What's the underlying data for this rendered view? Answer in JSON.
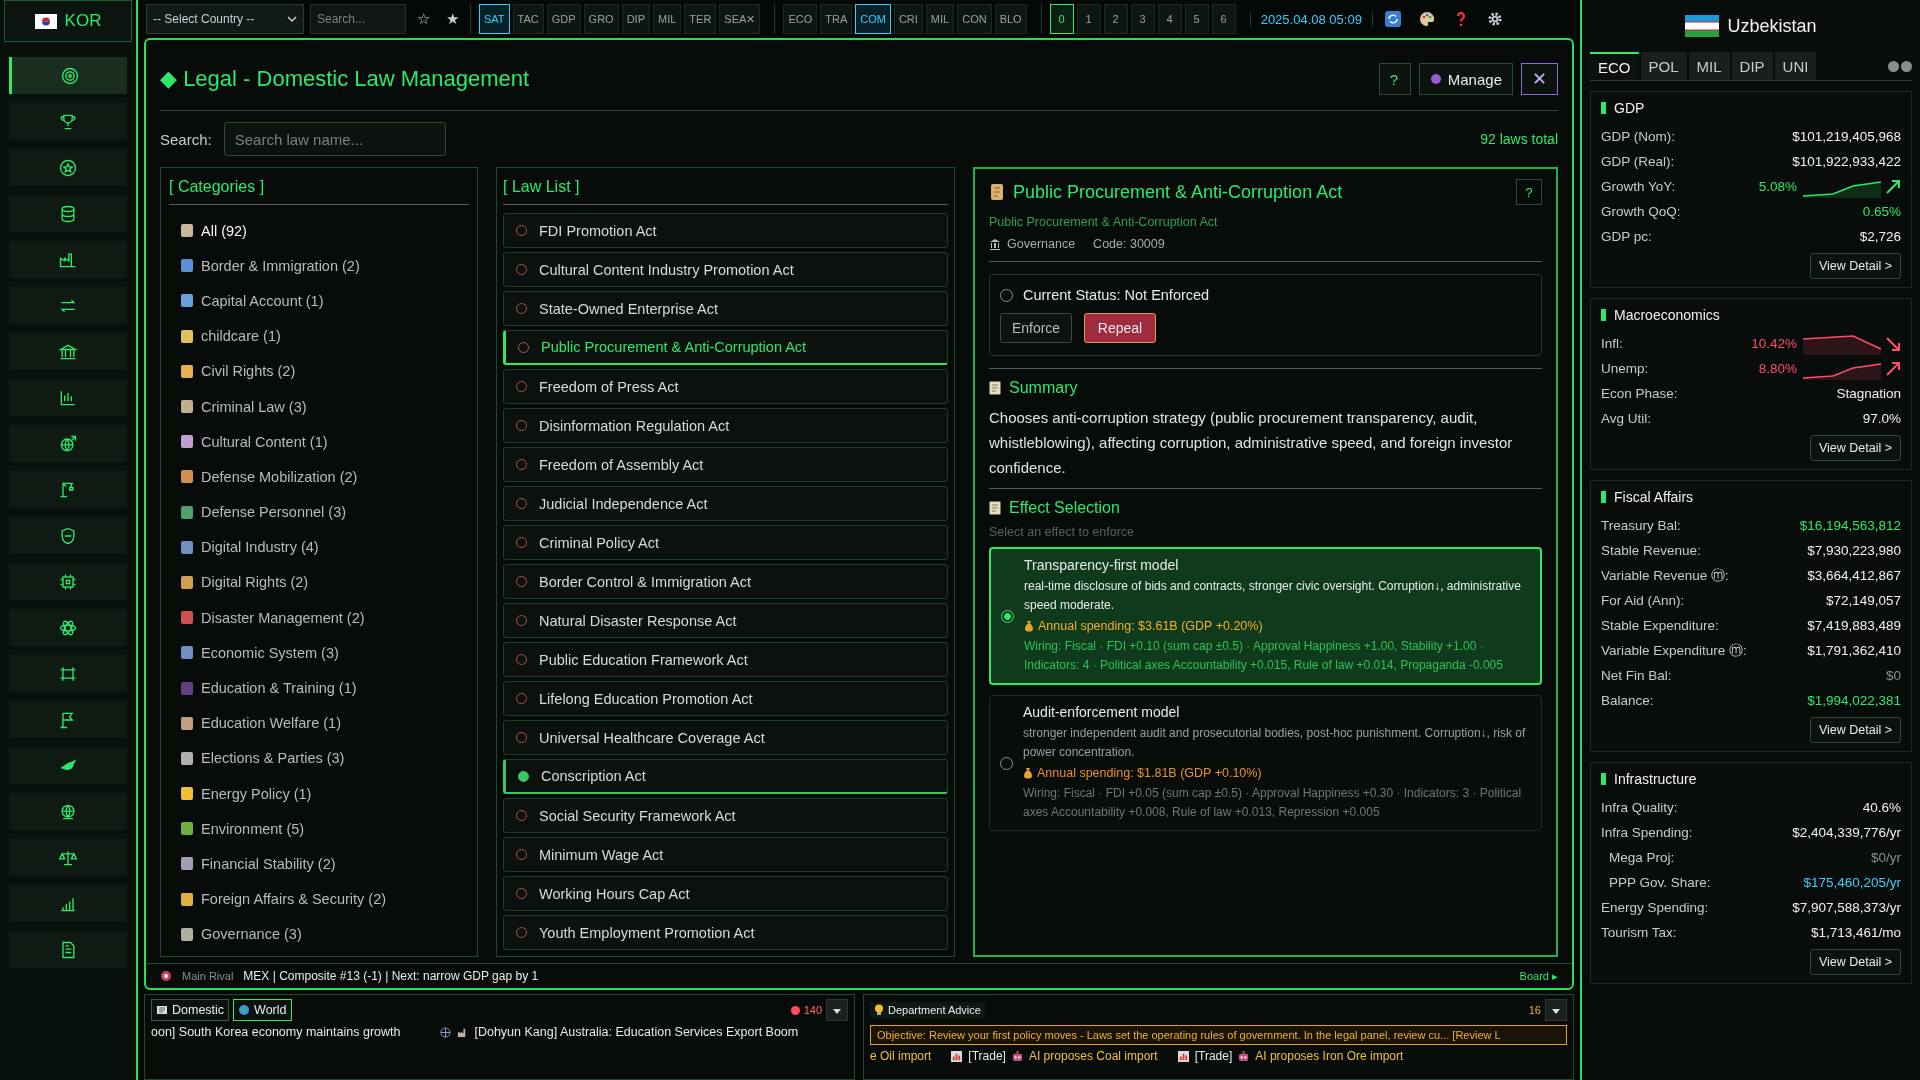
{
  "player": {
    "code": "KOR"
  },
  "toolbar": {
    "country_select": "-- Select Country --",
    "search": {
      "placeholder": "Search..."
    },
    "star_buttons": [
      "☆",
      "★"
    ],
    "layer_tabs": [
      {
        "label": "SAT",
        "selected": true
      },
      {
        "label": "TAC",
        "selected": false
      },
      {
        "label": "GDP",
        "selected": false
      },
      {
        "label": "GRO",
        "selected": false
      },
      {
        "label": "DIP",
        "selected": false
      },
      {
        "label": "MIL",
        "selected": false
      },
      {
        "label": "TER",
        "selected": false
      },
      {
        "label": "SEA✕",
        "selected": false
      }
    ],
    "view_tabs": [
      {
        "label": "ECO",
        "selected": false
      },
      {
        "label": "TRA",
        "selected": false
      },
      {
        "label": "COM",
        "selected": true
      },
      {
        "label": "CRI",
        "selected": false
      },
      {
        "label": "MIL",
        "selected": false
      },
      {
        "label": "CON",
        "selected": false
      },
      {
        "label": "BLO",
        "selected": false
      }
    ],
    "speed_tabs": [
      {
        "label": "0",
        "selected": true
      },
      {
        "label": "1",
        "selected": false
      },
      {
        "label": "2",
        "selected": false
      },
      {
        "label": "3",
        "selected": false
      },
      {
        "label": "4",
        "selected": false
      },
      {
        "label": "5",
        "selected": false
      },
      {
        "label": "6",
        "selected": false
      }
    ],
    "datetime": "2025.04.08 05:09"
  },
  "sidebar": {
    "items": [
      {
        "selected": true
      },
      {
        "selected": false
      },
      {
        "selected": false
      },
      {
        "selected": false
      },
      {
        "selected": false
      },
      {
        "selected": false
      },
      {
        "selected": false
      },
      {
        "selected": false
      },
      {
        "selected": false
      },
      {
        "selected": false
      },
      {
        "selected": false
      },
      {
        "selected": false
      },
      {
        "selected": false
      },
      {
        "selected": false
      },
      {
        "selected": false
      },
      {
        "selected": false
      },
      {
        "selected": false
      },
      {
        "selected": false
      },
      {
        "selected": false
      },
      {
        "selected": false
      }
    ]
  },
  "modal": {
    "title": "Legal - Domestic Law Management",
    "title_mark": "◆",
    "help": "?",
    "manage": "Manage",
    "close": "✕",
    "search_label": "Search:",
    "search": {
      "placeholder": "Search law name..."
    },
    "total": "92 laws total",
    "categories_title": "[ Categories ]",
    "categories": [
      {
        "label": "All (92)",
        "selected": true
      },
      {
        "label": "Border & Immigration (2)",
        "selected": false
      },
      {
        "label": "Capital Account (1)",
        "selected": false
      },
      {
        "label": "childcare (1)",
        "selected": false
      },
      {
        "label": "Civil Rights (2)",
        "selected": false
      },
      {
        "label": "Criminal Law (3)",
        "selected": false
      },
      {
        "label": "Cultural Content (1)",
        "selected": false
      },
      {
        "label": "Defense Mobilization (2)",
        "selected": false
      },
      {
        "label": "Defense Personnel (3)",
        "selected": false
      },
      {
        "label": "Digital Industry (4)",
        "selected": false
      },
      {
        "label": "Digital Rights (2)",
        "selected": false
      },
      {
        "label": "Disaster Management (2)",
        "selected": false
      },
      {
        "label": "Economic System (3)",
        "selected": false
      },
      {
        "label": "Education & Training (1)",
        "selected": false
      },
      {
        "label": "Education Welfare (1)",
        "selected": false
      },
      {
        "label": "Elections & Parties (3)",
        "selected": false
      },
      {
        "label": "Energy Policy (1)",
        "selected": false
      },
      {
        "label": "Environment (5)",
        "selected": false
      },
      {
        "label": "Financial Stability (2)",
        "selected": false
      },
      {
        "label": "Foreign Affairs & Security (2)",
        "selected": false
      },
      {
        "label": "Governance (3)",
        "selected": false
      }
    ],
    "laws_title": "[ Law List ]",
    "laws": [
      {
        "name": "FDI Promotion Act",
        "selected": false,
        "enforced": false
      },
      {
        "name": "Cultural Content Industry Promotion Act",
        "selected": false,
        "enforced": false
      },
      {
        "name": "State-Owned Enterprise Act",
        "selected": false,
        "enforced": false
      },
      {
        "name": "Public Procurement & Anti-Corruption Act",
        "selected": true,
        "enforced": false
      },
      {
        "name": "Freedom of Press Act",
        "selected": false,
        "enforced": false
      },
      {
        "name": "Disinformation Regulation Act",
        "selected": false,
        "enforced": false
      },
      {
        "name": "Freedom of Assembly Act",
        "selected": false,
        "enforced": false
      },
      {
        "name": "Judicial Independence Act",
        "selected": false,
        "enforced": false
      },
      {
        "name": "Criminal Policy Act",
        "selected": false,
        "enforced": false
      },
      {
        "name": "Border Control & Immigration Act",
        "selected": false,
        "enforced": false
      },
      {
        "name": "Natural Disaster Response Act",
        "selected": false,
        "enforced": false
      },
      {
        "name": "Public Education Framework Act",
        "selected": false,
        "enforced": false
      },
      {
        "name": "Lifelong Education Promotion Act",
        "selected": false,
        "enforced": false
      },
      {
        "name": "Universal Healthcare Coverage Act",
        "selected": false,
        "enforced": false
      },
      {
        "name": "Conscription Act",
        "selected": false,
        "enforced": true
      },
      {
        "name": "Social Security Framework Act",
        "selected": false,
        "enforced": false
      },
      {
        "name": "Minimum Wage Act",
        "selected": false,
        "enforced": false
      },
      {
        "name": "Working Hours Cap Act",
        "selected": false,
        "enforced": false
      },
      {
        "name": "Youth Employment Promotion Act",
        "selected": false,
        "enforced": false
      }
    ],
    "detail": {
      "title": "Public Procurement & Anti-Corruption Act",
      "subtitle": "Public Procurement & Anti-Corruption Act",
      "category": "Governance",
      "code": "Code: 30009",
      "help": "?",
      "status": {
        "label": "Current Status: Not Enforced",
        "enforced": false
      },
      "enforce": "Enforce",
      "repeal": "Repeal",
      "summary_title": "Summary",
      "summary": "Chooses anti-corruption strategy (public procurement transparency, audit, whistleblowing), affecting corruption, administrative speed, and foreign investor confidence.",
      "effects_title": "Effect Selection",
      "effects_hint": "Select an effect to enforce",
      "effects": [
        {
          "title": "Transparency-first model",
          "description": "real-time disclosure of bids and contracts, stronger civic oversight. Corruption↓, administrative speed moderate.",
          "spending": "Annual spending: $3.61B (GDP +0.20%)",
          "wiring": "Wiring: Fiscal · FDI +0.10 (sum cap ±0.5) · Approval Happiness +1.00, Stability +1.00 · Indicators: 4 · Political axes Accountability +0.015, Rule of law +0.014, Propaganda -0.005",
          "selected": true
        },
        {
          "title": "Audit-enforcement model",
          "description": "stronger independent audit and prosecutorial bodies, post-hoc punishment. Corruption↓, risk of power concentration.",
          "spending": "Annual spending: $1.81B (GDP +0.10%)",
          "wiring": "Wiring: Fiscal · FDI +0.05 (sum cap ±0.5) · Approval Happiness +0.30 · Indicators: 3 · Political axes Accountability +0.008, Rule of law +0.013, Repression +0.005",
          "selected": false
        }
      ]
    },
    "footer": {
      "rival_label": "Main Rival",
      "rival_info": "MEX | Composite #13 (-1) | Next: narrow GDP gap by 1",
      "board": "Board ▸"
    }
  },
  "news": {
    "tabs": [
      {
        "label": "Domestic",
        "selected": false
      },
      {
        "label": "World",
        "selected": true
      }
    ],
    "count": "140",
    "items": [
      {
        "text": "oon] South Korea economy maintains growth"
      },
      {
        "text": "[Dohyun Kang] Australia: Education Services Export Boom"
      }
    ]
  },
  "advice": {
    "title": "Department Advice",
    "count": "16",
    "objective": "Objective: Review your first policy moves - Laws set the operating rules of government. In the legal panel, review cu... [Review L",
    "items": [
      {
        "text": "e Oil import"
      },
      {
        "tag": "[Trade]",
        "text": "AI proposes Coal import"
      },
      {
        "tag": "[Trade]",
        "text": "AI proposes Iron Ore import"
      }
    ]
  },
  "country_panel": {
    "name": "Uzbekistan",
    "tabs": [
      {
        "label": "ECO",
        "selected": true
      },
      {
        "label": "POL",
        "selected": false
      },
      {
        "label": "MIL",
        "selected": false
      },
      {
        "label": "DIP",
        "selected": false
      },
      {
        "label": "UNI",
        "selected": false
      }
    ],
    "sections": [
      {
        "title": "GDP",
        "button": "View Detail >",
        "rows": [
          {
            "label": "GDP (Nom):",
            "value": "$101,219,405,968",
            "color": "#f0f2f0",
            "kind": "plain"
          },
          {
            "label": "GDP (Real):",
            "value": "$101,922,933,422",
            "color": "#f0f2f0",
            "kind": "plain"
          },
          {
            "label": "Growth YoY:",
            "value": "5.08%",
            "color": "#2ee86a",
            "kind": "trend",
            "rising": true
          },
          {
            "label": "Growth QoQ:",
            "value": "0.65%",
            "color": "#2ee86a",
            "kind": "plain"
          },
          {
            "label": "GDP pc:",
            "value": "$2,726",
            "color": "#f0f2f0",
            "kind": "plain"
          }
        ]
      },
      {
        "title": "Macroeconomics",
        "button": "View Detail >",
        "rows": [
          {
            "label": "Infl:",
            "value": "10.42%",
            "color": "#ff4d6a",
            "kind": "trend",
            "rising": false
          },
          {
            "label": "Unemp:",
            "value": "8.80%",
            "color": "#ff4d6a",
            "kind": "trend",
            "rising": true
          },
          {
            "label": "Econ Phase:",
            "value": "Stagnation",
            "color": "#f0f2f0",
            "kind": "plain"
          },
          {
            "label": "Avg Util:",
            "value": "97.0%",
            "color": "#f0f2f0",
            "kind": "plain"
          }
        ]
      },
      {
        "title": "Fiscal Affairs",
        "button": "View Detail >",
        "rows": [
          {
            "label": "Treasury Bal:",
            "value": "$16,194,563,812",
            "color": "#2ee86a",
            "kind": "plain"
          },
          {
            "label": "Stable Revenue:",
            "value": "$7,930,223,980",
            "color": "#f0f2f0",
            "kind": "plain"
          },
          {
            "label": "Variable Revenue ⓜ:",
            "value": "$3,664,412,867",
            "color": "#f0f2f0",
            "kind": "plain"
          },
          {
            "label": "For Aid (Ann):",
            "value": "$72,149,057",
            "color": "#f0f2f0",
            "kind": "plain"
          },
          {
            "label": "Stable Expenditure:",
            "value": "$7,419,883,489",
            "color": "#f0f2f0",
            "kind": "plain"
          },
          {
            "label": "Variable Expenditure ⓜ:",
            "value": "$1,791,362,410",
            "color": "#f0f2f0",
            "kind": "plain"
          },
          {
            "label": "Net Fin Bal:",
            "value": "$0",
            "color": "#8a918c",
            "kind": "plain"
          },
          {
            "label": "Balance:",
            "value": "$1,994,022,381",
            "color": "#2ee86a",
            "kind": "plain"
          }
        ]
      },
      {
        "title": "Infrastructure",
        "button": "View Detail >",
        "rows": [
          {
            "label": "Infra Quality:",
            "value": "40.6%",
            "color": "#f0f2f0",
            "kind": "plain"
          },
          {
            "label": "Infra Spending:",
            "value": "$2,404,339,776/yr",
            "color": "#f0f2f0",
            "kind": "plain"
          },
          {
            "label": "Mega Proj:",
            "value": "$0/yr",
            "color": "#8a918c",
            "kind": "sub"
          },
          {
            "label": "PPP Gov. Share:",
            "value": "$175,460,205/yr",
            "color": "#3fd0ff",
            "kind": "sub"
          },
          {
            "label": "Energy Spending:",
            "value": "$7,907,588,373/yr",
            "color": "#f0f2f0",
            "kind": "plain"
          },
          {
            "label": "Tourism Tax:",
            "value": "$1,713,461/mo",
            "color": "#f0f2f0",
            "kind": "plain"
          }
        ]
      }
    ]
  }
}
